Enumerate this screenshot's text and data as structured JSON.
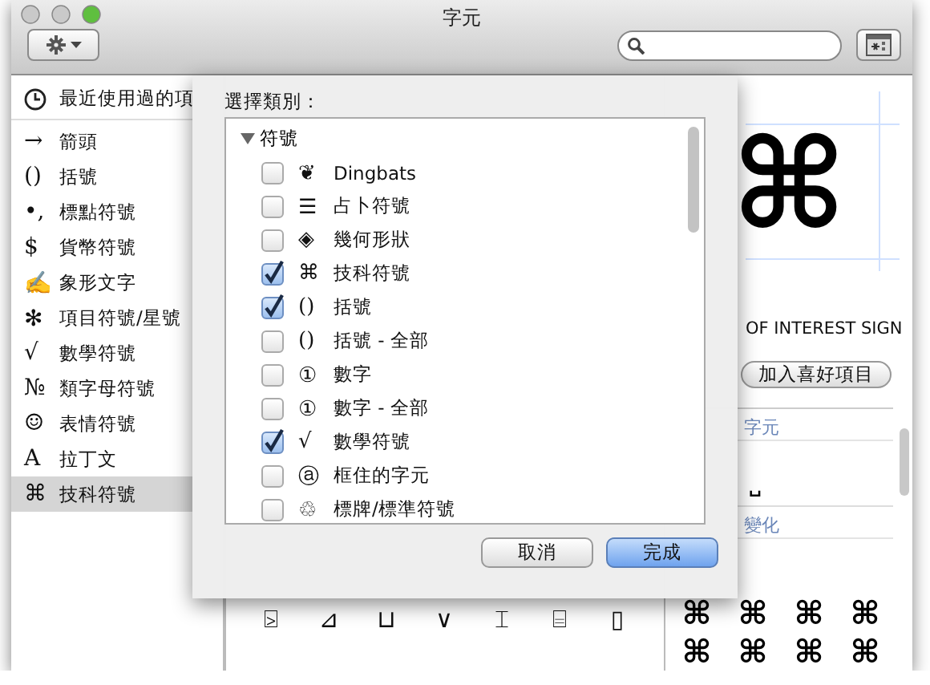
{
  "window": {
    "title": "字元"
  },
  "sidebar": {
    "items": [
      {
        "kind": "clock",
        "label": "最近使用過的項",
        "selected": false
      },
      {
        "kind": "glyph",
        "icon": "→",
        "label": "箭頭",
        "selected": false
      },
      {
        "kind": "glyph",
        "icon": "()",
        "label": "括號",
        "selected": false
      },
      {
        "kind": "glyph",
        "icon": "•,",
        "label": "標點符號",
        "selected": false
      },
      {
        "kind": "glyph",
        "icon": "$",
        "label": "貨幣符號",
        "selected": false
      },
      {
        "kind": "glyph",
        "icon": "✍",
        "label": "象形文字",
        "selected": false
      },
      {
        "kind": "glyph",
        "icon": "✻",
        "label": "項目符號/星號",
        "selected": false
      },
      {
        "kind": "glyph",
        "icon": "√",
        "label": "數學符號",
        "selected": false
      },
      {
        "kind": "glyph",
        "icon": "№",
        "label": "類字母符號",
        "selected": false
      },
      {
        "kind": "glyph",
        "icon": "☺",
        "label": "表情符號",
        "selected": false
      },
      {
        "kind": "glyph",
        "icon": "A",
        "label": "拉丁文",
        "selected": false
      },
      {
        "kind": "glyph",
        "icon": "⌘",
        "label": "技科符號",
        "selected": true
      }
    ]
  },
  "character_grid": {
    "rows": [
      [
        "⍄",
        "⊿",
        "⊔",
        "∨",
        "⌶",
        "⌸",
        "▯"
      ]
    ]
  },
  "detail": {
    "glyph": "⌘",
    "name": "OF INTEREST SIGN",
    "favorite_button": "加入喜好項目",
    "sections": [
      {
        "title": "字元",
        "glyphs": [
          "␣"
        ]
      },
      {
        "title": "變化",
        "glyphs": [
          "⌘",
          "⌘",
          "⌘",
          "⌘",
          "⌘",
          "⌘",
          "⌘",
          "⌘"
        ]
      }
    ]
  },
  "sheet": {
    "title": "選擇類別：",
    "group": {
      "label": "符號",
      "expanded": true,
      "items": [
        {
          "icon": "❦",
          "label": "Dingbats",
          "checked": false
        },
        {
          "icon": "☰",
          "label": "占卜符號",
          "checked": false
        },
        {
          "icon": "◈",
          "label": "幾何形狀",
          "checked": false
        },
        {
          "icon": "⌘",
          "label": "技科符號",
          "checked": true
        },
        {
          "icon": "()",
          "label": "括號",
          "checked": true
        },
        {
          "icon": "()",
          "label": "括號 - 全部",
          "checked": false
        },
        {
          "icon": "①",
          "label": "數字",
          "checked": false
        },
        {
          "icon": "①",
          "label": "數字 - 全部",
          "checked": false
        },
        {
          "icon": "√",
          "label": "數學符號",
          "checked": true
        },
        {
          "icon": "ⓐ",
          "label": "框住的字元",
          "checked": false
        },
        {
          "icon": "♲",
          "label": "標牌/標準符號",
          "checked": false
        }
      ]
    },
    "buttons": [
      {
        "label": "取消",
        "kind": "cancel"
      },
      {
        "label": "完成",
        "kind": "default"
      }
    ]
  }
}
